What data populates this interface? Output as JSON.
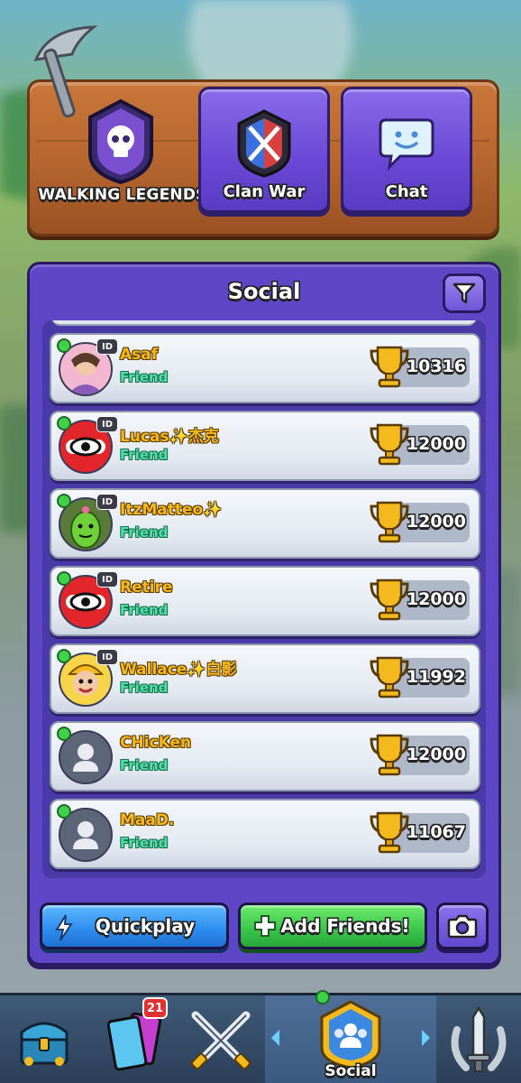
{
  "clan": {
    "name": "WALKING LEGENDS"
  },
  "tabs": {
    "clan_war": "Clan War",
    "chat": "Chat"
  },
  "panel": {
    "title": "Social"
  },
  "friends": [
    {
      "name": "Asaf",
      "status": "Friend",
      "trophies": "10316",
      "avatar": "queen-avatar-icon",
      "has_id": true
    },
    {
      "name": "Lucas✨杰克",
      "status": "Friend",
      "trophies": "12000",
      "avatar": "eye-emblem-icon",
      "has_id": true
    },
    {
      "name": "ItzMatteo✨",
      "status": "Friend",
      "trophies": "12000",
      "avatar": "spike-cactus-icon",
      "has_id": true
    },
    {
      "name": "Retire",
      "status": "Friend",
      "trophies": "12000",
      "avatar": "eye-emblem-icon",
      "has_id": true
    },
    {
      "name": "Wallace✨白影",
      "status": "Friend",
      "trophies": "11992",
      "avatar": "miner-avatar-icon",
      "has_id": true
    },
    {
      "name": "CHicKen",
      "status": "Friend",
      "trophies": "12000",
      "avatar": "default-person-icon",
      "has_id": false
    },
    {
      "name": "MaaD.",
      "status": "Friend",
      "trophies": "11067",
      "avatar": "default-person-icon",
      "has_id": false
    }
  ],
  "id_tag": "ID",
  "buttons": {
    "quickplay": "Quickplay",
    "add_friends": "Add Friends!"
  },
  "nav": {
    "cards_badge": "21",
    "social_label": "Social"
  },
  "colors": {
    "panel": "#5e47c7",
    "friend_status": "#4fe0a4",
    "name": "#f6b81c",
    "online": "#3fd24a"
  }
}
